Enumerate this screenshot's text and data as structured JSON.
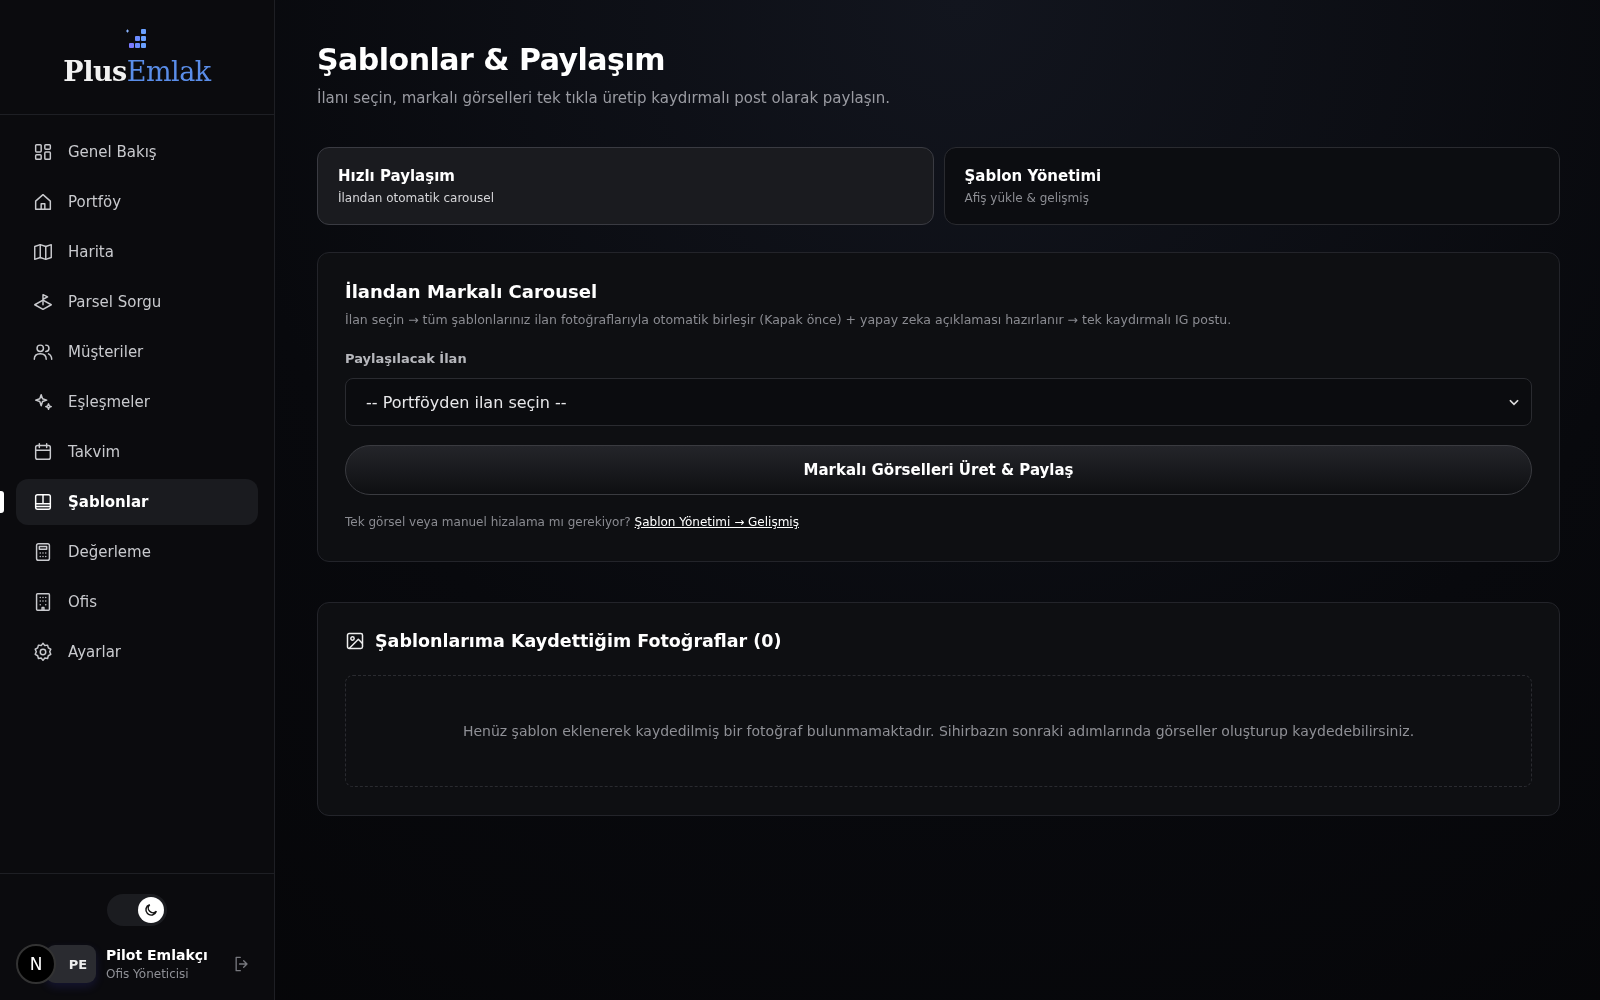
{
  "sidebar": {
    "logo": {
      "first": "Plus",
      "second": "Emlak"
    },
    "items": [
      {
        "label": "Genel Bakış",
        "selected": false
      },
      {
        "label": "Portföy",
        "selected": false
      },
      {
        "label": "Harita",
        "selected": false
      },
      {
        "label": "Parsel Sorgu",
        "selected": false
      },
      {
        "label": "Müşteriler",
        "selected": false
      },
      {
        "label": "Eşleşmeler",
        "selected": false
      },
      {
        "label": "Takvim",
        "selected": false
      },
      {
        "label": "Şablonlar",
        "selected": true
      },
      {
        "label": "Değerleme",
        "selected": false
      },
      {
        "label": "Ofis",
        "selected": false
      },
      {
        "label": "Ayarlar",
        "selected": false
      }
    ],
    "theme_toggle": {
      "on": true
    },
    "badge": "N",
    "user": {
      "initials": "PE",
      "name": "Pilot Emlakçı",
      "role": "Ofis Yöneticisi"
    }
  },
  "page": {
    "title": "Şablonlar & Paylaşım",
    "subtitle": "İlanı seçin, markalı görselleri tek tıkla üretip kaydırmalı post olarak paylaşın."
  },
  "tabs": [
    {
      "title": "Hızlı Paylaşım",
      "subtitle": "İlandan otomatik carousel",
      "selected": true
    },
    {
      "title": "Şablon Yönetimi",
      "subtitle": "Afiş yükle & gelişmiş",
      "selected": false
    }
  ],
  "carousel_card": {
    "title": "İlandan Markalı Carousel",
    "description": "İlan seçin → tüm şablonlarınız ilan fotoğraflarıyla otomatik birleşir (Kapak önce) + yapay zeka açıklaması hazırlanır → tek kaydırmalı IG postu.",
    "field_label": "Paylaşılacak İlan",
    "select_value": "-- Portföyden ilan seçin --",
    "button": "Markalı Görselleri Üret & Paylaş",
    "hint": "Tek görsel veya manuel hizalama mı gerekiyor?",
    "hint_link": "Şablon Yönetimi → Gelişmiş"
  },
  "photos_card": {
    "title": "Şablonlarıma Kaydettiğim Fotoğraflar (0)",
    "empty_text": "Henüz şablon eklenerek kaydedilmiş bir fotoğraf bulunmamaktadır. Sihirbazın sonraki adımlarında görseller oluşturup kaydedebilirsiniz."
  }
}
